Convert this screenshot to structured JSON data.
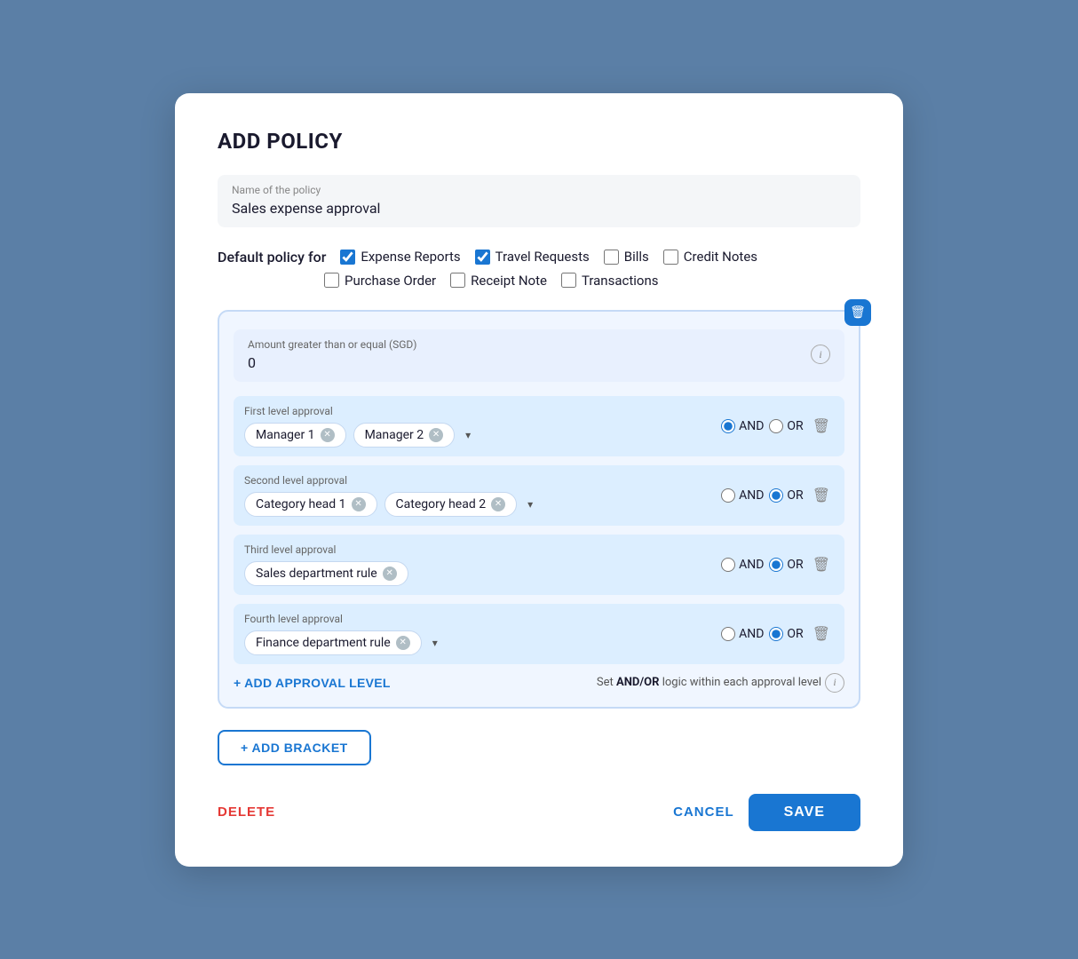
{
  "modal": {
    "title": "ADD POLICY",
    "policy_name_label": "Name of the policy",
    "policy_name_value": "Sales expense approval",
    "default_policy_label": "Default policy for",
    "checkboxes": [
      {
        "id": "cb-expense",
        "label": "Expense Reports",
        "checked": true
      },
      {
        "id": "cb-travel",
        "label": "Travel Requests",
        "checked": true
      },
      {
        "id": "cb-bills",
        "label": "Bills",
        "checked": false
      },
      {
        "id": "cb-credit",
        "label": "Credit Notes",
        "checked": false
      },
      {
        "id": "cb-purchase",
        "label": "Purchase Order",
        "checked": false
      },
      {
        "id": "cb-receipt",
        "label": "Receipt Note",
        "checked": false
      },
      {
        "id": "cb-transactions",
        "label": "Transactions",
        "checked": false
      }
    ],
    "bracket": {
      "amount_label": "Amount greater than or equal (SGD)",
      "amount_value": "0",
      "approval_levels": [
        {
          "label": "First level approval",
          "tags": [
            "Manager 1",
            "Manager 2"
          ],
          "has_dropdown": true,
          "and_selected": true,
          "or_selected": false
        },
        {
          "label": "Second level approval",
          "tags": [
            "Category head 1",
            "Category head 2"
          ],
          "has_dropdown": true,
          "and_selected": false,
          "or_selected": true
        },
        {
          "label": "Third level approval",
          "tags": [
            "Sales department rule"
          ],
          "has_dropdown": false,
          "and_selected": false,
          "or_selected": true
        },
        {
          "label": "Fourth level approval",
          "tags": [
            "Finance department rule"
          ],
          "has_dropdown": true,
          "and_selected": false,
          "or_selected": true
        }
      ],
      "add_level_btn": "+ ADD APPROVAL LEVEL",
      "andor_logic_text": "Set AND/OR logic within each approval level"
    },
    "add_bracket_btn": "+ ADD BRACKET",
    "delete_btn": "DELETE",
    "cancel_btn": "CANCEL",
    "save_btn": "SAVE"
  }
}
